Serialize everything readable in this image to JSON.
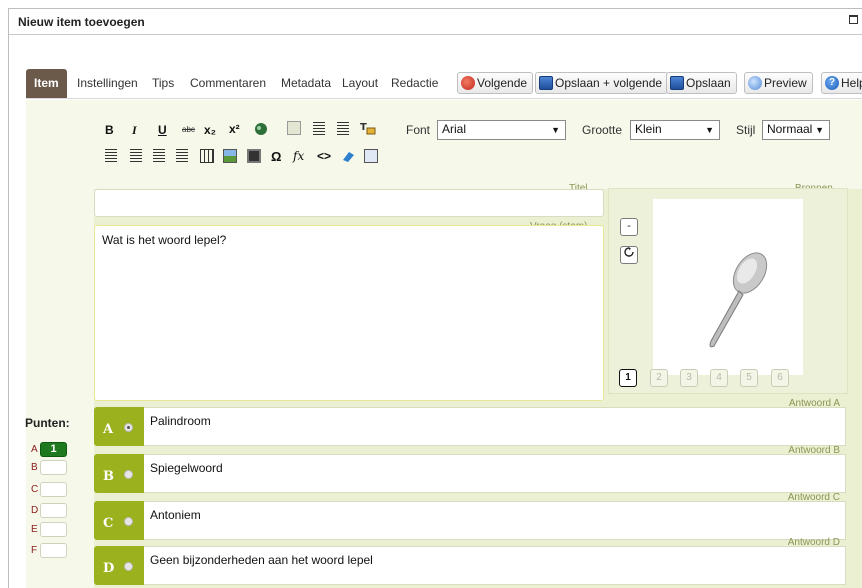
{
  "window": {
    "title": "Nieuw item toevoegen"
  },
  "tabs": [
    {
      "label": "Item"
    },
    {
      "label": "Instellingen"
    },
    {
      "label": "Tips"
    },
    {
      "label": "Commentaren"
    },
    {
      "label": "Metadata"
    },
    {
      "label": "Layout"
    },
    {
      "label": "Redactie"
    }
  ],
  "toolbar": {
    "next_label": "Volgende",
    "save_next_label": "Opslaan + volgende",
    "save_label": "Opslaan",
    "preview_label": "Preview",
    "help_label": "Help"
  },
  "format": {
    "bold": "B",
    "italic": "I",
    "underline": "U",
    "strike": "abc",
    "sub": "x₂",
    "sup": "x²",
    "omega": "Ω",
    "fx": "fx",
    "code": "<>",
    "font_label": "Font",
    "font_value": "Arial",
    "size_label": "Grootte",
    "size_value": "Klein",
    "style_label": "Stijl",
    "style_value": "Normaal"
  },
  "question": {
    "title_label": "Titel",
    "title_value": "",
    "stem_label": "Vraag (stam)",
    "stem_value": "Wat is het woord lepel?"
  },
  "sources": {
    "label": "Bronnen",
    "minus": "-",
    "pages": [
      "1",
      "2",
      "3",
      "4",
      "5",
      "6"
    ],
    "active_page": "1",
    "image": "spoon-image"
  },
  "points": {
    "label": "Punten:",
    "rows": [
      {
        "letter": "A",
        "value": "1"
      },
      {
        "letter": "B",
        "value": ""
      },
      {
        "letter": "C",
        "value": ""
      },
      {
        "letter": "D",
        "value": ""
      },
      {
        "letter": "E",
        "value": ""
      },
      {
        "letter": "F",
        "value": ""
      }
    ]
  },
  "answers": [
    {
      "letter": "A",
      "label": "Antwoord A",
      "text": "Palindroom",
      "selected": true
    },
    {
      "letter": "B",
      "label": "Antwoord B",
      "text": "Spiegelwoord",
      "selected": false
    },
    {
      "letter": "C",
      "label": "Antwoord C",
      "text": "Antoniem",
      "selected": false
    },
    {
      "letter": "D",
      "label": "Antwoord D",
      "text": "Geen bijzonderheden aan het woord lepel",
      "selected": false
    }
  ],
  "colors": {
    "accent": "#9bb11e",
    "panel": "#f6f8ea",
    "active_tab": "#6b5a4a",
    "points_fill": "#1f7a1f"
  }
}
